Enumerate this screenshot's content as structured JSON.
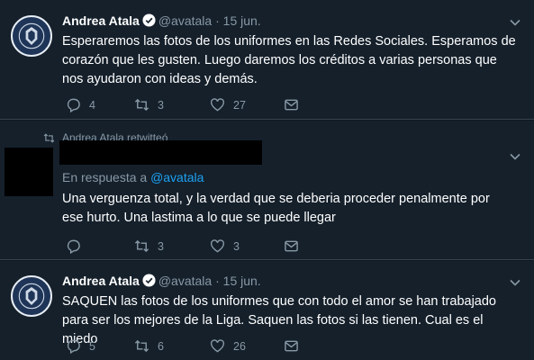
{
  "colors": {
    "background": "#15202b",
    "accent": "#1da1f2",
    "muted": "#8899a6",
    "divider": "#38444d"
  },
  "tweets": [
    {
      "author": "Andrea Atala",
      "handle": "@avatala",
      "separator": "·",
      "date": "15 jun.",
      "text": "Esperaremos las fotos de los uniformes en las Redes Sociales. Esperamos de corazón que les gusten. Luego daremos los créditos a varias personas que nos ayudaron con ideas y demás.",
      "replies": "4",
      "retweets": "3",
      "likes": "27"
    },
    {
      "retweeted_by": "Andrea Atala retwitteó",
      "reply_prefix": "En respuesta a",
      "reply_to": "@avatala",
      "text": "Una verguenza total, y la verdad que se deberia proceder penalmente por ese hurto. Una lastima a lo que se puede llegar",
      "replies": "",
      "retweets": "3",
      "likes": "3"
    },
    {
      "author": "Andrea Atala",
      "handle": "@avatala",
      "separator": "·",
      "date": "15 jun.",
      "text": "SAQUEN las fotos de los uniformes que con todo el amor se han trabajado para ser los mejores de la Liga. Saquen las fotos si las tienen. Cual es el miedo",
      "replies": "5",
      "retweets": "6",
      "likes": "26"
    }
  ],
  "icons": [
    "reply-icon",
    "retweet-icon",
    "like-icon",
    "direct-message-icon",
    "chevron-down-icon",
    "verified-badge-icon"
  ]
}
